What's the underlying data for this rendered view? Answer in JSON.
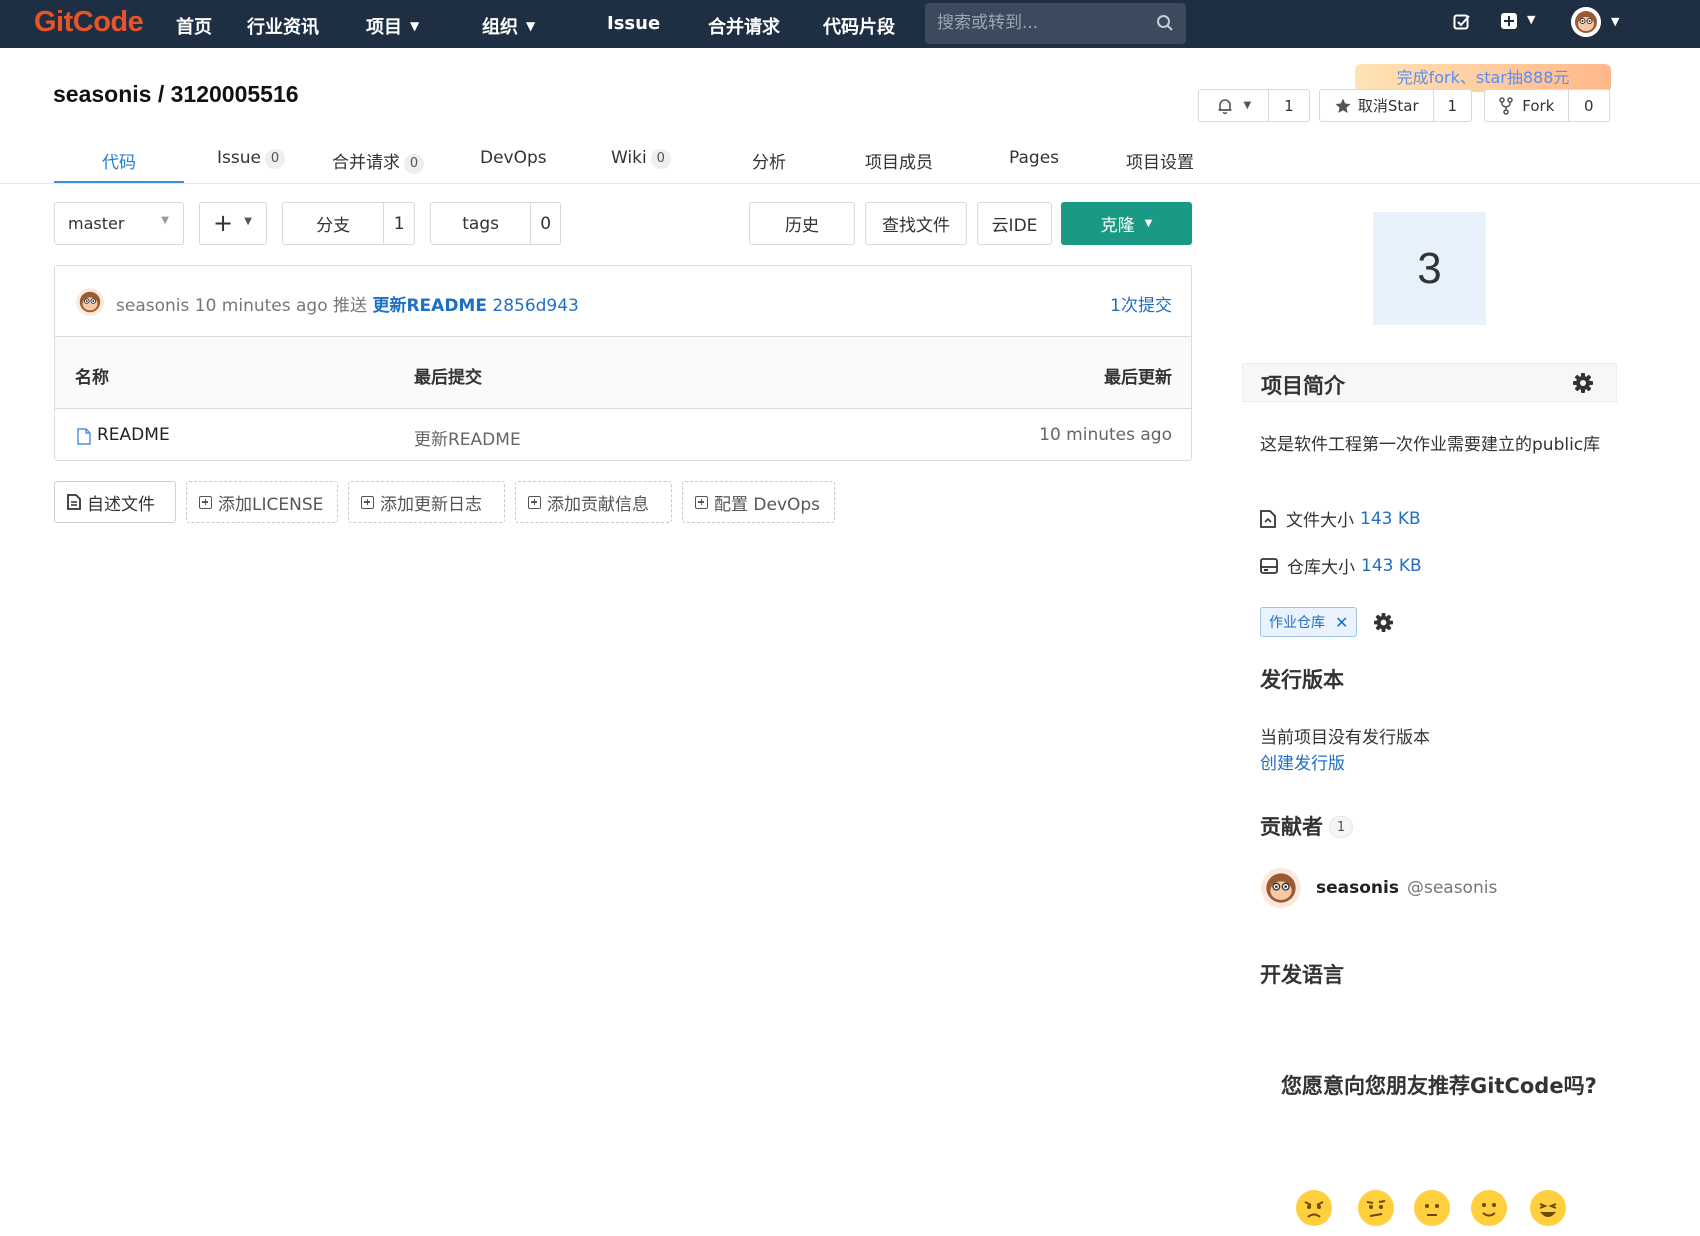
{
  "topnav": {
    "logo": "GitCode",
    "items": [
      "首页",
      "行业资讯",
      "项目",
      "组织",
      "Issue",
      "合并请求",
      "代码片段"
    ],
    "search_placeholder": "搜索或转到..."
  },
  "header": {
    "repo_title": "seasonis / 3120005516",
    "promo": "完成fork、star抽888元",
    "watch_count": "1",
    "star_label": "取消Star",
    "star_count": "1",
    "fork_label": "Fork",
    "fork_count": "0"
  },
  "tabs": [
    {
      "label": "代码"
    },
    {
      "label": "Issue",
      "count": "0"
    },
    {
      "label": "合并请求",
      "count": "0"
    },
    {
      "label": "DevOps"
    },
    {
      "label": "Wiki",
      "count": "0"
    },
    {
      "label": "分析"
    },
    {
      "label": "项目成员"
    },
    {
      "label": "Pages"
    },
    {
      "label": "项目设置"
    }
  ],
  "toolbar": {
    "branch": "master",
    "plus": "+",
    "branches_label": "分支",
    "branches_count": "1",
    "tags_label": "tags",
    "tags_count": "0",
    "history": "历史",
    "find_file": "查找文件",
    "cloud_ide": "云IDE",
    "clone": "克隆"
  },
  "commit": {
    "author": "seasonis",
    "time": "10 minutes ago",
    "action": "推送",
    "message": "更新README",
    "sha": "2856d943",
    "count_label": "1次提交"
  },
  "file_table": {
    "headers": [
      "名称",
      "最后提交",
      "最后更新"
    ],
    "rows": [
      {
        "name": "README",
        "last_commit": "更新README",
        "updated": "10 minutes ago"
      }
    ]
  },
  "quick_actions": [
    "自述文件",
    "添加LICENSE",
    "添加更新日志",
    "添加贡献信息",
    "配置 DevOps"
  ],
  "sidebar": {
    "tile_value": "3",
    "about_title": "项目简介",
    "description": "这是软件工程第一次作业需要建立的public库",
    "file_size_label": "文件大小",
    "file_size": "143 KB",
    "repo_size_label": "仓库大小",
    "repo_size": "143 KB",
    "tag": "作业仓库",
    "releases_title": "发行版本",
    "releases_empty": "当前项目没有发行版本",
    "create_release": "创建发行版",
    "contributors_title": "贡献者",
    "contributors_count": "1",
    "contributor_name": "seasonis",
    "contributor_handle": "@seasonis",
    "languages_title": "开发语言",
    "recommend_question": "您愿意向您朋友推荐GitCode吗?"
  },
  "colors": {
    "nav_bg": "#1e2f43",
    "accent": "#1f7fd6",
    "clone_btn": "#1a9a84",
    "logo": "#e8542a"
  }
}
